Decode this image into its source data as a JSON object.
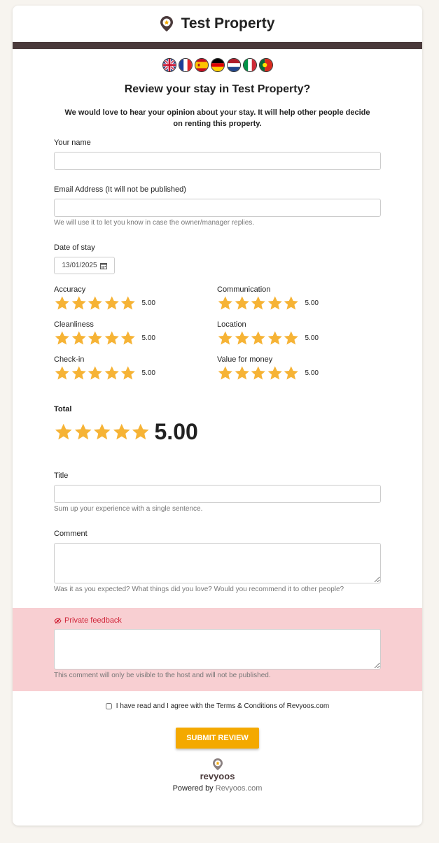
{
  "property": {
    "name": "Test Property"
  },
  "flags": [
    "English",
    "French",
    "Spanish",
    "German",
    "Dutch",
    "Italian",
    "Portuguese"
  ],
  "heading": "Review your stay in Test Property?",
  "intro": "We would love to hear your opinion about your stay. It will help other people decide on renting this property.",
  "fields": {
    "name_label": "Your name",
    "name_value": "",
    "email_label": "Email Address (It will not be published)",
    "email_value": "",
    "email_help": "We will use it to let you know in case the owner/manager replies.",
    "date_label": "Date of stay",
    "date_value": "13/01/2025",
    "title_label": "Title",
    "title_value": "",
    "title_help": "Sum up your experience with a single sentence.",
    "comment_label": "Comment",
    "comment_value": "",
    "comment_help": "Was it as you expected? What things did you love? Would you recommend it to other people?",
    "private_label": "Private feedback",
    "private_value": "",
    "private_help": "This comment will only be visible to the host and will not be published."
  },
  "ratings": [
    {
      "label": "Accuracy",
      "score": "5.00",
      "stars": 5
    },
    {
      "label": "Communication",
      "score": "5.00",
      "stars": 5
    },
    {
      "label": "Cleanliness",
      "score": "5.00",
      "stars": 5
    },
    {
      "label": "Location",
      "score": "5.00",
      "stars": 5
    },
    {
      "label": "Check-in",
      "score": "5.00",
      "stars": 5
    },
    {
      "label": "Value for money",
      "score": "5.00",
      "stars": 5
    }
  ],
  "total": {
    "label": "Total",
    "score": "5.00",
    "stars": 5
  },
  "terms": {
    "label": "I have read and I agree with the Terms & Conditions of Revyoos.com",
    "checked": false
  },
  "submit_label": "SUBMIT REVIEW",
  "footer": {
    "logo_text": "revyoos",
    "powered_prefix": "Powered by ",
    "powered_link": "Revyoos.com"
  },
  "colors": {
    "accent": "#f4a900",
    "star": "#f6b335",
    "header_bar": "#4a3a3b",
    "private_bg": "#f8cfd2",
    "private_text": "#d0263a"
  },
  "icons": {
    "location": "map-pin-icon",
    "calendar": "calendar-icon",
    "private": "eye-slash-icon",
    "star": "star-icon"
  }
}
